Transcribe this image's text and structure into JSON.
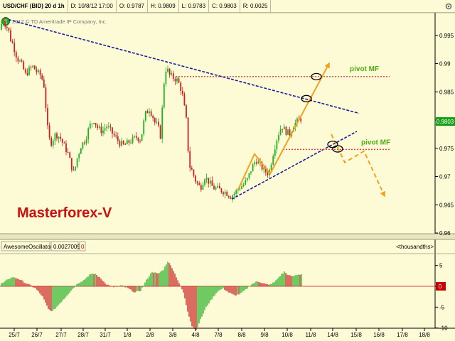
{
  "header": {
    "symbol": "USD/CHF (BID) 20 d 1h",
    "date": "D: 10/8/12 17:00",
    "open": "O: 0.9787",
    "high": "H: 0.9809",
    "low": "L: 0.9783",
    "close": "C: 0.9803",
    "range": "R: 0.0025"
  },
  "copyright": "2012 © TD Ameritrade IP Company, Inc.",
  "watermark": "Masterforex-V",
  "annotations": {
    "pivot_upper": "pivot MF",
    "pivot_lower": "pivot MF"
  },
  "indicator": {
    "name": "AwesomeOscillator",
    "value": "0.0027009",
    "zero": "0",
    "units": "<thousandths>"
  },
  "colors": {
    "background": "#fdfbd6",
    "candle_up": "#22b022",
    "candle_down": "#cc2020",
    "trendline": "#1a1aa0",
    "pivot_line": "#e04040",
    "arrow": "#f5a020",
    "pivot_text": "#4cae10",
    "watermark": "#cc1010",
    "price_marker": "#14a014",
    "zero_marker": "#cc0000"
  },
  "chart_data": [
    {
      "type": "candlestick",
      "title": "USD/CHF (BID) 20 d 1h",
      "x_tick_labels": [
        "25/7",
        "26/7",
        "27/7",
        "28/7",
        "31/7",
        "1/8",
        "2/8",
        "3/8",
        "4/8",
        "7/8",
        "8/8",
        "9/8",
        "10/8",
        "11/8",
        "14/8",
        "15/8",
        "16/8",
        "17/8",
        "18/8"
      ],
      "y_ticks": [
        0.995,
        0.99,
        0.985,
        0.98,
        0.975,
        0.97,
        0.965,
        0.96
      ],
      "ylim": [
        0.96,
        0.9985
      ],
      "last_price": "0.9803",
      "price_path": [
        [
          0,
          0.996
        ],
        [
          4,
          0.998
        ],
        [
          8,
          0.9968
        ],
        [
          12,
          0.996
        ],
        [
          14,
          0.9945
        ],
        [
          18,
          0.9935
        ],
        [
          24,
          0.991
        ],
        [
          30,
          0.99
        ],
        [
          36,
          0.988
        ],
        [
          40,
          0.9888
        ],
        [
          46,
          0.9895
        ],
        [
          52,
          0.9885
        ],
        [
          58,
          0.9878
        ],
        [
          62,
          0.986
        ],
        [
          68,
          0.977
        ],
        [
          72,
          0.976
        ],
        [
          78,
          0.9775
        ],
        [
          84,
          0.977
        ],
        [
          90,
          0.9755
        ],
        [
          96,
          0.974
        ],
        [
          100,
          0.972
        ],
        [
          104,
          0.9705
        ],
        [
          108,
          0.973
        ],
        [
          114,
          0.9755
        ],
        [
          120,
          0.9765
        ],
        [
          126,
          0.979
        ],
        [
          132,
          0.98
        ],
        [
          138,
          0.9785
        ],
        [
          144,
          0.978
        ],
        [
          150,
          0.979
        ],
        [
          156,
          0.978
        ],
        [
          162,
          0.977
        ],
        [
          168,
          0.976
        ],
        [
          174,
          0.9755
        ],
        [
          180,
          0.976
        ],
        [
          186,
          0.9765
        ],
        [
          192,
          0.977
        ],
        [
          198,
          0.9765
        ],
        [
          204,
          0.981
        ],
        [
          210,
          0.982
        ],
        [
          214,
          0.981
        ],
        [
          218,
          0.9795
        ],
        [
          222,
          0.979
        ],
        [
          226,
          0.977
        ],
        [
          230,
          0.986
        ],
        [
          234,
          0.9895
        ],
        [
          238,
          0.988
        ],
        [
          244,
          0.9875
        ],
        [
          250,
          0.987
        ],
        [
          256,
          0.985
        ],
        [
          262,
          0.98
        ],
        [
          266,
          0.972
        ],
        [
          270,
          0.971
        ],
        [
          276,
          0.969
        ],
        [
          282,
          0.968
        ],
        [
          288,
          0.97
        ],
        [
          294,
          0.969
        ],
        [
          300,
          0.968
        ],
        [
          306,
          0.9678
        ],
        [
          312,
          0.9675
        ],
        [
          318,
          0.9672
        ],
        [
          324,
          0.9665
        ],
        [
          330,
          0.967
        ],
        [
          336,
          0.968
        ],
        [
          342,
          0.9685
        ],
        [
          348,
          0.9695
        ],
        [
          354,
          0.9715
        ],
        [
          360,
          0.973
        ],
        [
          366,
          0.972
        ],
        [
          372,
          0.971
        ],
        [
          378,
          0.9705
        ],
        [
          384,
          0.974
        ],
        [
          390,
          0.977
        ],
        [
          396,
          0.979
        ],
        [
          402,
          0.978
        ],
        [
          408,
          0.9775
        ],
        [
          412,
          0.979
        ],
        [
          416,
          0.9795
        ],
        [
          420,
          0.98
        ],
        [
          424,
          0.9803
        ]
      ],
      "trendlines": [
        {
          "name": "down-trendline",
          "from": [
            12,
            0.9978
          ],
          "to": [
            505,
            0.9812
          ]
        },
        {
          "name": "up-trendline",
          "from": [
            326,
            0.966
          ],
          "to": [
            502,
            0.978
          ]
        }
      ],
      "pivot_levels": [
        {
          "label": "pivot MF",
          "y": 0.9877,
          "x_start": 247,
          "x_end": 548
        },
        {
          "label": "pivot MF",
          "y": 0.9748,
          "x_start": 398,
          "x_end": 548
        }
      ],
      "arrow_paths": [
        {
          "name": "rally-zigzag",
          "points": [
            [
              335,
              0.9677
            ],
            [
              358,
              0.974
            ],
            [
              380,
              0.9705
            ],
            [
              462,
              0.9898
            ]
          ]
        },
        {
          "name": "projected-decline",
          "points": [
            [
              466,
              0.9775
            ],
            [
              485,
              0.9725
            ],
            [
              512,
              0.9745
            ],
            [
              540,
              0.9668
            ]
          ],
          "dashed": true
        }
      ],
      "circles": [
        {
          "name": "circle-pivot-upper",
          "x": 445,
          "y": 0.9877
        },
        {
          "name": "circle-trend-cross",
          "x": 431,
          "y": 0.9838
        },
        {
          "name": "circle-lower-1",
          "x": 468,
          "y": 0.9757
        },
        {
          "name": "circle-lower-2",
          "x": 475,
          "y": 0.9749
        }
      ]
    },
    {
      "type": "bar",
      "title": "AwesomeOscillator",
      "y_ticks": [
        5,
        0,
        -5,
        -10
      ],
      "ylim": [
        -11,
        7
      ],
      "values_path": [
        [
          0,
          0.5
        ],
        [
          6,
          1.0
        ],
        [
          12,
          1.8
        ],
        [
          18,
          2.2
        ],
        [
          26,
          1.8
        ],
        [
          34,
          1.0
        ],
        [
          42,
          0.3
        ],
        [
          50,
          -0.5
        ],
        [
          60,
          -2.5
        ],
        [
          68,
          -5.5
        ],
        [
          74,
          -6.0
        ],
        [
          82,
          -4.5
        ],
        [
          90,
          -3.0
        ],
        [
          100,
          -1.0
        ],
        [
          110,
          0.8
        ],
        [
          118,
          1.5
        ],
        [
          126,
          2.8
        ],
        [
          134,
          3.0
        ],
        [
          142,
          1.8
        ],
        [
          150,
          0.5
        ],
        [
          160,
          -0.3
        ],
        [
          170,
          0.2
        ],
        [
          180,
          -0.5
        ],
        [
          190,
          -1.5
        ],
        [
          198,
          -1.0
        ],
        [
          206,
          1.5
        ],
        [
          214,
          3.5
        ],
        [
          222,
          3.0
        ],
        [
          230,
          4.0
        ],
        [
          236,
          6.0
        ],
        [
          242,
          4.5
        ],
        [
          250,
          1.5
        ],
        [
          258,
          -1.5
        ],
        [
          264,
          -6.0
        ],
        [
          270,
          -9.5
        ],
        [
          276,
          -10.5
        ],
        [
          282,
          -8.0
        ],
        [
          290,
          -5.0
        ],
        [
          298,
          -3.0
        ],
        [
          306,
          -1.2
        ],
        [
          314,
          -0.5
        ],
        [
          322,
          -1.5
        ],
        [
          330,
          -2.2
        ],
        [
          338,
          -1.8
        ],
        [
          346,
          -0.8
        ],
        [
          354,
          0.5
        ],
        [
          362,
          1.2
        ],
        [
          370,
          0.8
        ],
        [
          378,
          0.3
        ],
        [
          386,
          1.0
        ],
        [
          394,
          2.5
        ],
        [
          400,
          3.5
        ],
        [
          406,
          2.6
        ],
        [
          412,
          2.4
        ],
        [
          418,
          2.8
        ],
        [
          424,
          2.9
        ]
      ]
    }
  ]
}
